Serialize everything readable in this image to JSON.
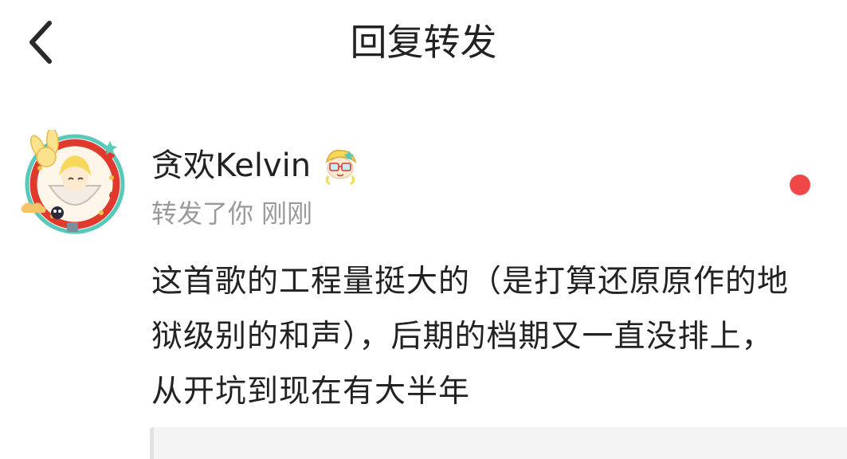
{
  "header": {
    "back_icon": "chevron-left-icon",
    "title": "回复转发"
  },
  "notification": {
    "avatar_icon": "user-avatar",
    "username": "贪欢Kelvin",
    "badge_icon": "cartoon-badge-icon",
    "action": "转发了你",
    "time": "刚刚",
    "unread": true,
    "unread_color": "#f04848",
    "content": "这首歌的工程量挺大的（是打算还原原作的地狱级别的和声），后期的档期又一直没排上，从开坑到现在有大半年"
  },
  "colors": {
    "text_primary": "#222222",
    "text_secondary": "#9a9a9a",
    "quote_background": "#f4f4f5"
  }
}
